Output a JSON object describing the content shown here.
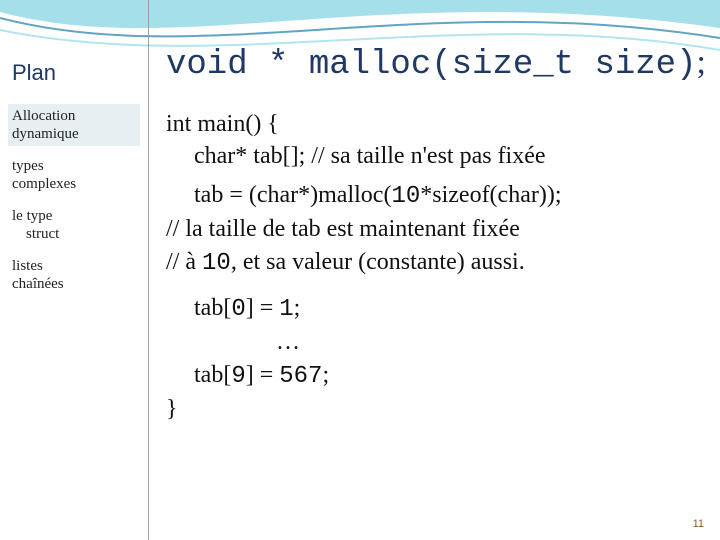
{
  "sidebar": {
    "heading": "Plan",
    "items": [
      {
        "line1": "Allocation",
        "line2": "dynamique",
        "active": true
      },
      {
        "line1": "types",
        "line2": "complexes",
        "active": false
      },
      {
        "line1": "le type",
        "line2": "struct",
        "active": false,
        "indent2": true
      },
      {
        "line1": "listes",
        "line2": "chaînées",
        "active": false
      }
    ]
  },
  "content": {
    "heading_pre": "void *   malloc(size_t   size)",
    "heading_post": ";",
    "code": {
      "l1": "int main() {",
      "l2a": "char* tab[]; ",
      "l2b": "// sa taille n'est pas fixée",
      "l3a": "tab = (char*)malloc(",
      "l3b": "10",
      "l3c": "*sizeof(char));",
      "l4": "//  la taille de tab est maintenant fixée",
      "l5a": "// à ",
      "l5b": "10",
      "l5c": ", et sa valeur (constante) aussi.",
      "l6a": "tab[",
      "l6b": "0",
      "l6c": "] = ",
      "l6d": "1",
      "l6e": ";",
      "l7": "…",
      "l8a": "tab[",
      "l8b": "9",
      "l8c": "] = ",
      "l8d": "567",
      "l8e": ";",
      "l9": "}"
    }
  },
  "footer": "11"
}
